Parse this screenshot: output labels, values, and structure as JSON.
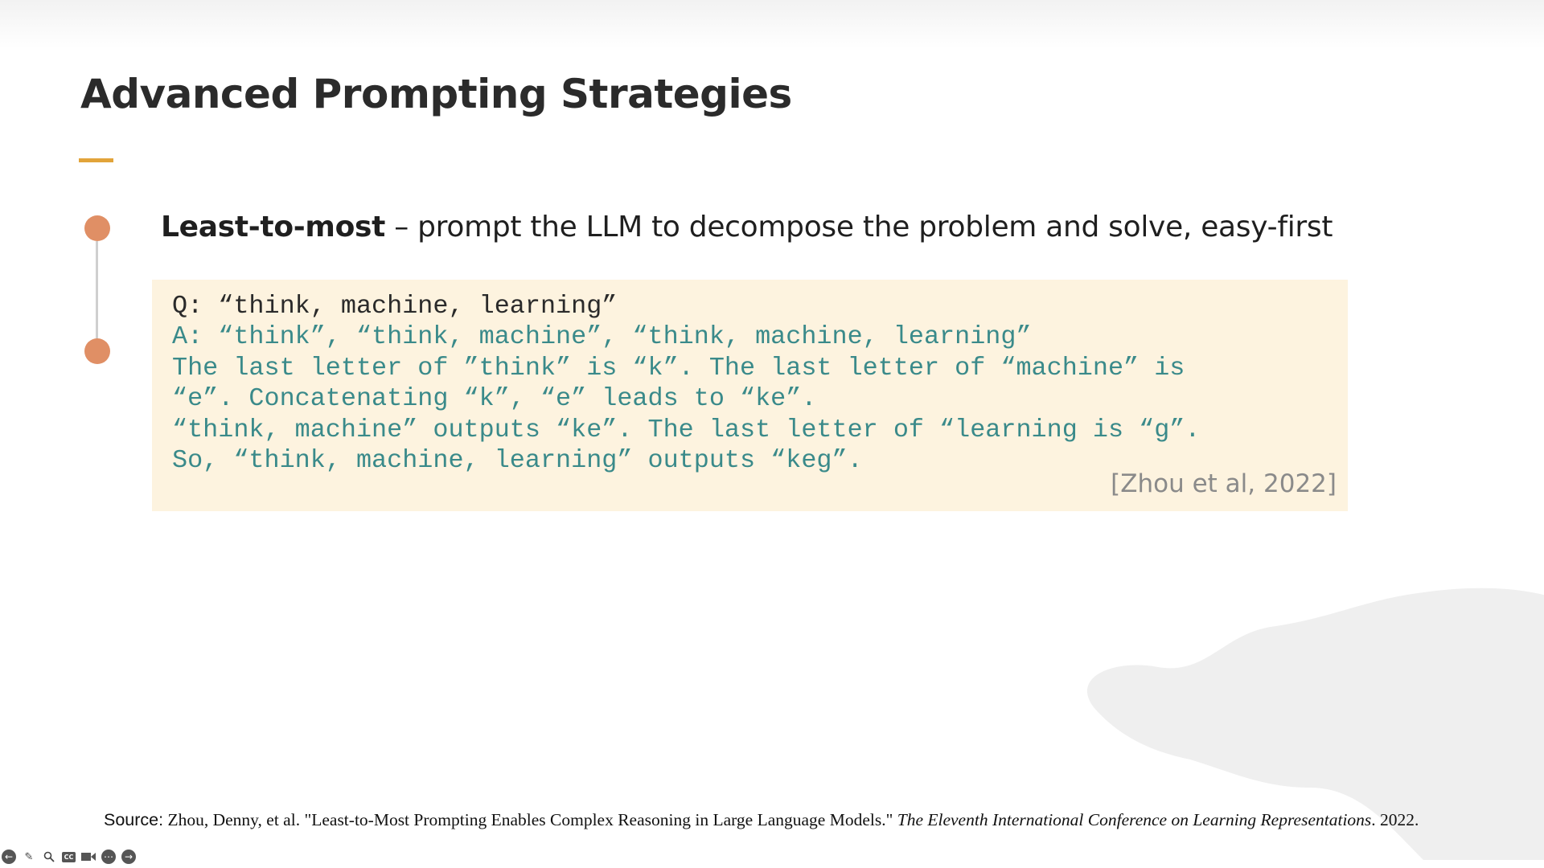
{
  "slide": {
    "title": "Advanced Prompting Strategies",
    "bullet": {
      "term": "Least-to-most",
      "description": " – prompt the LLM to decompose the problem and solve, easy-first"
    },
    "example": {
      "lines": [
        "Q: “think, machine, learning”",
        "A: “think”, “think, machine”, “think, machine, learning”",
        "The last letter of ”think” is “k”. The last letter of “machine” is",
        "“e”. Concatenating “k”, “e” leads to “ke”.",
        "“think, machine” outputs “ke”. The last letter of “learning is “g”.",
        "So, “think, machine, learning” outputs “keg”."
      ],
      "citation": "[Zhou et al, 2022]"
    },
    "source": {
      "label": "Source:",
      "text": " Zhou, Denny, et al. \"Least-to-Most Prompting Enables Complex Reasoning in Large Language Models.\" ",
      "venue": "The Eleventh International Conference on Learning Representations",
      "year": ". 2022."
    }
  },
  "player_controls": {
    "icons": [
      "previous-icon",
      "pen-icon",
      "zoom-icon",
      "captions-icon",
      "camera-icon",
      "more-icon",
      "next-icon"
    ],
    "captions_label": "CC"
  },
  "colors": {
    "accent_rule": "#e2a43a",
    "timeline_dot": "#e08f65",
    "example_bg": "#fdf3df",
    "answer_text": "#3a8a8a"
  }
}
